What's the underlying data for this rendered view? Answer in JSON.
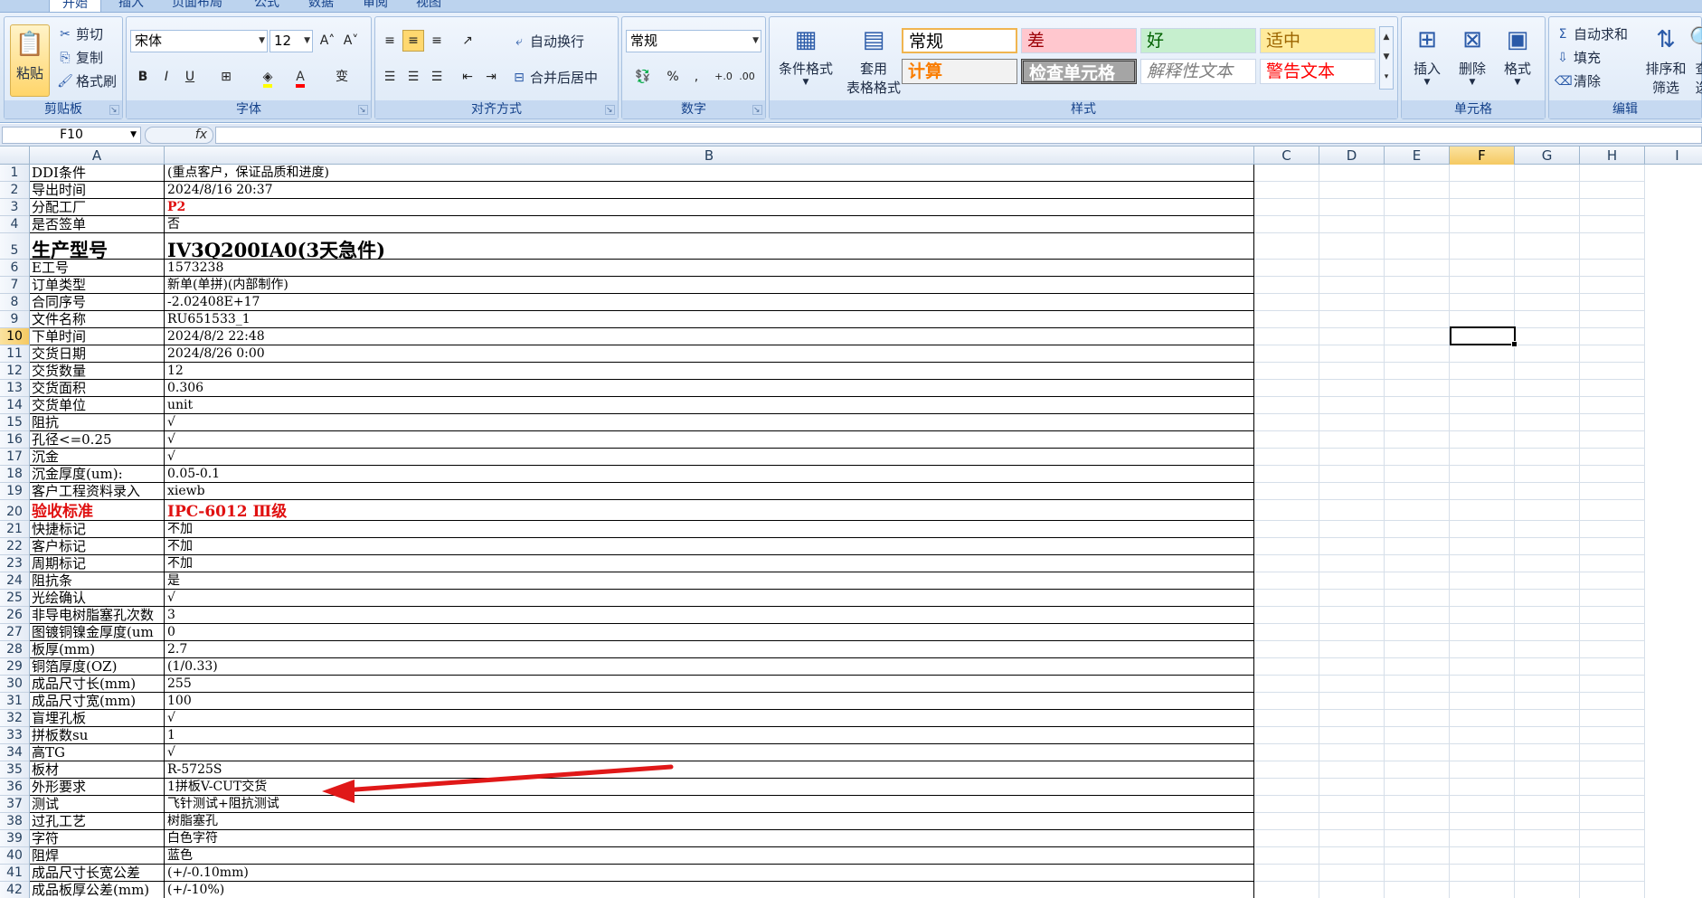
{
  "tabs": [
    "开始",
    "插入",
    "页面布局",
    "公式",
    "数据",
    "审阅",
    "视图"
  ],
  "clipboard": {
    "paste": "粘贴",
    "cut": "剪切",
    "copy": "复制",
    "format_painter": "格式刷",
    "group": "剪贴板"
  },
  "font": {
    "name": "宋体",
    "size": "12",
    "bold": "B",
    "italic": "I",
    "underline": "U",
    "group": "字体"
  },
  "alignment": {
    "wrap": "自动换行",
    "merge": "合并后居中",
    "group": "对齐方式"
  },
  "number": {
    "format": "常规",
    "percent": "%",
    "comma": ",",
    "group": "数字"
  },
  "styles": {
    "cond_format": "条件格式",
    "table_format_1": "套用",
    "table_format_2": "表格格式",
    "normal": "常规",
    "bad": "差",
    "good": "好",
    "neutral": "适中",
    "calc": "计算",
    "check": "检查单元格",
    "explain": "解释性文本",
    "warning": "警告文本",
    "group": "样式"
  },
  "cells": {
    "insert": "插入",
    "delete": "删除",
    "format": "格式",
    "group": "单元格"
  },
  "editing": {
    "autosum": "自动求和",
    "fill": "填充",
    "clear": "清除",
    "sort_1": "排序和",
    "sort_2": "筛选",
    "find_1": "查",
    "find_2": "选",
    "group": "编辑"
  },
  "name_box": "F10",
  "fx": "fx",
  "columns": [
    "A",
    "B",
    "C",
    "D",
    "E",
    "F",
    "G",
    "H",
    "I"
  ],
  "rows": [
    {
      "n": "1",
      "a": "DDI条件",
      "b": "(重点客户，保证品质和进度)"
    },
    {
      "n": "2",
      "a": "导出时间",
      "b": "2024/8/16 20:37"
    },
    {
      "n": "3",
      "a": "分配工厂",
      "b": "P2"
    },
    {
      "n": "4",
      "a": "是否签单",
      "b": "否"
    },
    {
      "n": "5",
      "a": "生产型号",
      "b": "IV3Q200IA0(3天急件)"
    },
    {
      "n": "6",
      "a": "E工号",
      "b": "1573238"
    },
    {
      "n": "7",
      "a": "订单类型",
      "b": "新单(单拼)(内部制作)"
    },
    {
      "n": "8",
      "a": "合同序号",
      "b": "-2.02408E+17"
    },
    {
      "n": "9",
      "a": "文件名称",
      "b": "RU651533_1"
    },
    {
      "n": "10",
      "a": "下单时间",
      "b": "2024/8/2 22:48"
    },
    {
      "n": "11",
      "a": "交货日期",
      "b": "2024/8/26 0:00"
    },
    {
      "n": "12",
      "a": "交货数量",
      "b": "12"
    },
    {
      "n": "13",
      "a": "交货面积",
      "b": "0.306"
    },
    {
      "n": "14",
      "a": "交货单位",
      "b": "unit"
    },
    {
      "n": "15",
      "a": "阻抗",
      "b": "√"
    },
    {
      "n": "16",
      "a": "孔径<=0.25",
      "b": "√"
    },
    {
      "n": "17",
      "a": "沉金",
      "b": "√"
    },
    {
      "n": "18",
      "a": "沉金厚度(um):",
      "b": "0.05-0.1"
    },
    {
      "n": "19",
      "a": "客户工程资料录入",
      "b": "xiewb"
    },
    {
      "n": "20",
      "a": "验收标准",
      "b": "IPC-6012 Ⅲ级"
    },
    {
      "n": "21",
      "a": "快捷标记",
      "b": "不加"
    },
    {
      "n": "22",
      "a": "客户标记",
      "b": "不加"
    },
    {
      "n": "23",
      "a": "周期标记",
      "b": "不加"
    },
    {
      "n": "24",
      "a": "阻抗条",
      "b": "是"
    },
    {
      "n": "25",
      "a": "光绘确认",
      "b": "√"
    },
    {
      "n": "26",
      "a": "非导电树脂塞孔次数",
      "b": "3"
    },
    {
      "n": "27",
      "a": "图镀铜镍金厚度(um",
      "b": "0"
    },
    {
      "n": "28",
      "a": "板厚(mm)",
      "b": "2.7"
    },
    {
      "n": "29",
      "a": "铜箔厚度(OZ)",
      "b": " (1/0.33)"
    },
    {
      "n": "30",
      "a": "成品尺寸长(mm)",
      "b": "255"
    },
    {
      "n": "31",
      "a": "成品尺寸宽(mm)",
      "b": "100"
    },
    {
      "n": "32",
      "a": "盲埋孔板",
      "b": "√"
    },
    {
      "n": "33",
      "a": "拼板数su",
      "b": "1"
    },
    {
      "n": "34",
      "a": "高TG",
      "b": "√"
    },
    {
      "n": "35",
      "a": "板材",
      "b": "R-5725S"
    },
    {
      "n": "36",
      "a": "外形要求",
      "b": "1拼板V-CUT交货"
    },
    {
      "n": "37",
      "a": "测试",
      "b": "飞针测试+阻抗测试"
    },
    {
      "n": "38",
      "a": "过孔工艺",
      "b": "树脂塞孔"
    },
    {
      "n": "39",
      "a": "字符",
      "b": "白色字符"
    },
    {
      "n": "40",
      "a": "阻焊",
      "b": "蓝色"
    },
    {
      "n": "41",
      "a": "成品尺寸长宽公差",
      "b": "(+/-0.10mm)"
    },
    {
      "n": "42",
      "a": "成品板厚公差(mm)",
      "b": "(+/-10%)"
    }
  ],
  "annotation_color": "#e01818"
}
